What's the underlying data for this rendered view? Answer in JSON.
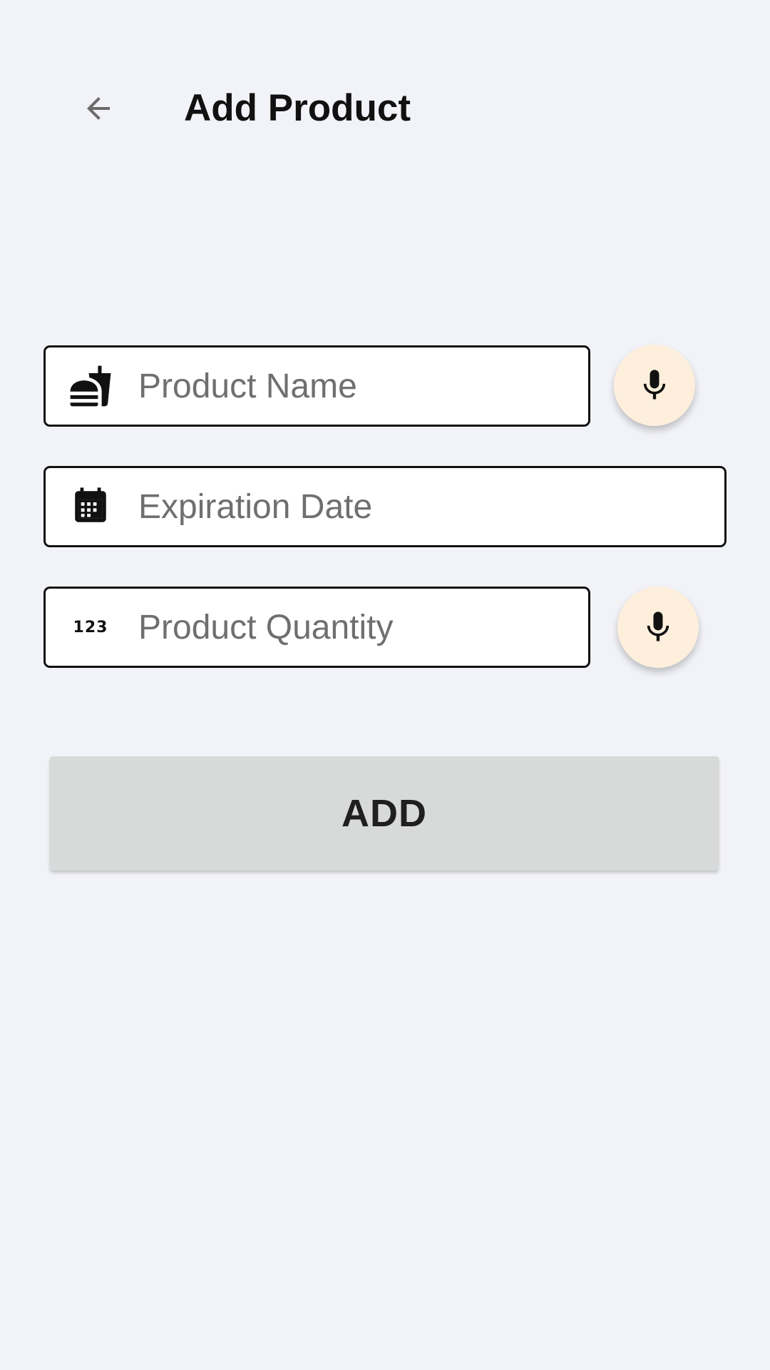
{
  "header": {
    "title": "Add Product",
    "back_icon": "arrow-back-icon"
  },
  "form": {
    "product_name": {
      "placeholder": "Product Name",
      "value": "",
      "icon": "fastfood-icon"
    },
    "expiration_date": {
      "placeholder": "Expiration Date",
      "value": "",
      "icon": "calendar-icon"
    },
    "product_quantity": {
      "placeholder": "Product Quantity",
      "value": "",
      "icon": "numbers-123-icon",
      "icon_glyph": "123"
    },
    "mic_icon": "microphone-icon",
    "add_label": "ADD"
  },
  "colors": {
    "background": "#f2f3f8",
    "field_border": "#111111",
    "mic_background": "#fdefdc",
    "button_background": "#d8d9d9"
  }
}
